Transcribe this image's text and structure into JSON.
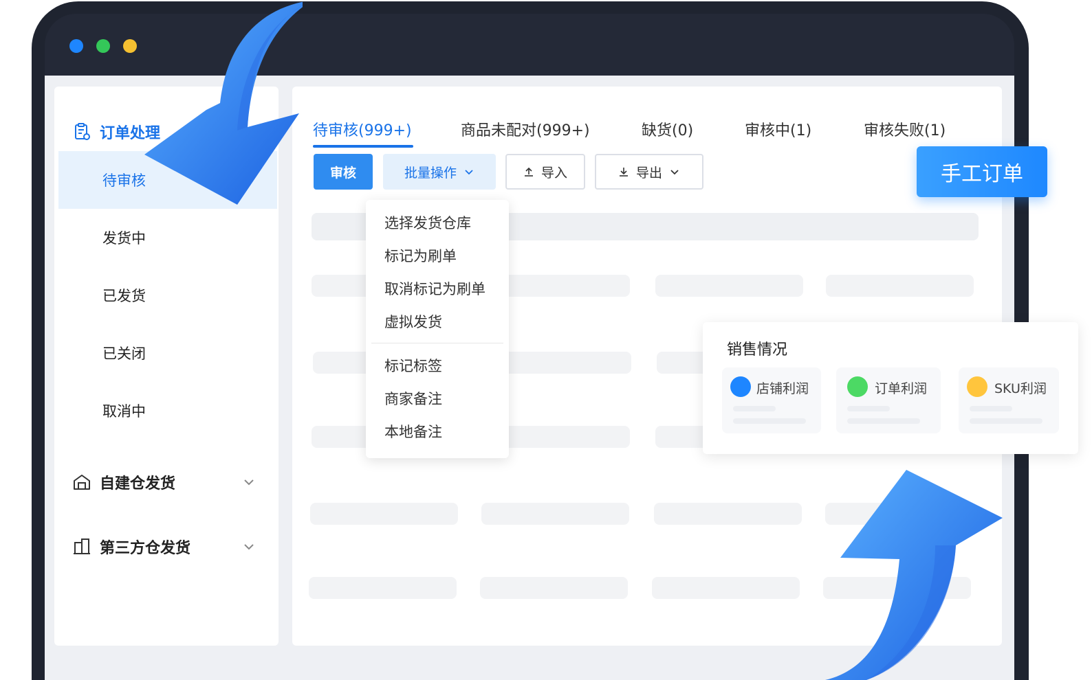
{
  "window": {
    "controls": [
      "close",
      "minimize",
      "maximize"
    ]
  },
  "sidebar": {
    "group_order": {
      "label": "订单处理",
      "icon": "order-clipboard-icon",
      "expanded": true
    },
    "items": [
      {
        "label": "待审核",
        "active": true
      },
      {
        "label": "发货中"
      },
      {
        "label": "已发货"
      },
      {
        "label": "已关闭"
      },
      {
        "label": "取消中"
      }
    ],
    "group_self_warehouse": {
      "label": "自建仓发货",
      "icon": "warehouse-icon"
    },
    "group_third_party": {
      "label": "第三方仓发货",
      "icon": "building-icon"
    }
  },
  "tabs": [
    {
      "label": "待审核(999+)",
      "active": true
    },
    {
      "label": "商品未配对(999+)"
    },
    {
      "label": "缺货(0)"
    },
    {
      "label": "审核中(1)"
    },
    {
      "label": "审核失败(1)"
    }
  ],
  "toolbar": {
    "review": "审核",
    "batch": "批量操作",
    "import": "导入",
    "export": "导出"
  },
  "batch_menu": {
    "items": [
      "选择发货仓库",
      "标记为刷单",
      "取消标记为刷单",
      "虚拟发货"
    ],
    "items2": [
      "标记标签",
      "商家备注",
      "本地备注"
    ]
  },
  "manual_order": "手工订单",
  "sales": {
    "title": "销售情况",
    "metrics": [
      {
        "label": "店铺利润",
        "color": "#1e86ff"
      },
      {
        "label": "订单利润",
        "color": "#4cd964"
      },
      {
        "label": "SKU利润",
        "color": "#ffc53d"
      }
    ]
  },
  "colors": {
    "accent": "#1a73e8",
    "primary_button": "#2f8cf0",
    "frame": "#1f2430"
  }
}
